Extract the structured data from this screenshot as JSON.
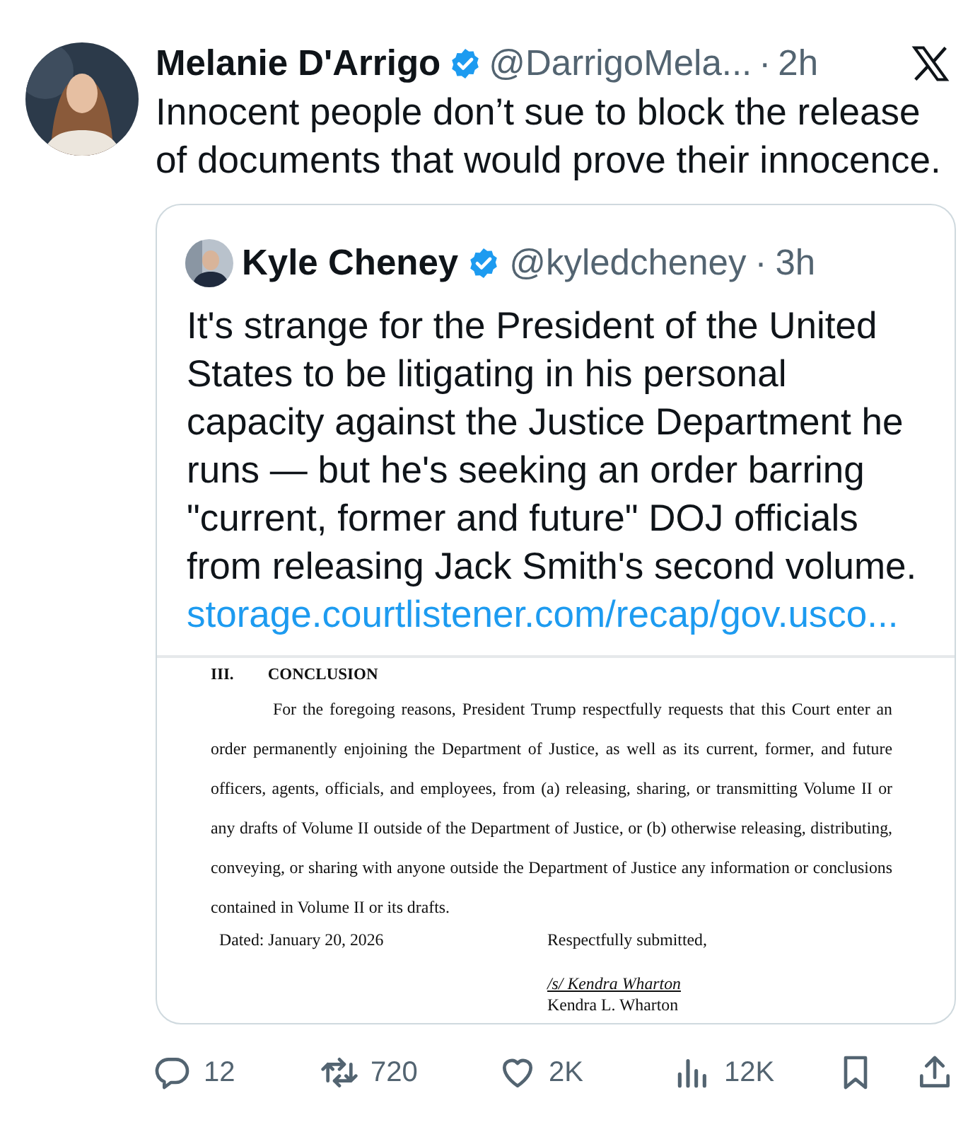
{
  "tweet": {
    "author": {
      "name": "Melanie D'Arrigo",
      "verified": true,
      "handle": "@DarrigoMela...",
      "separator": "·",
      "time": "2h"
    },
    "text": "Innocent people don’t sue to block the release of documents that would prove their innocence.",
    "quote": {
      "author": {
        "name": "Kyle Cheney",
        "verified": true,
        "handle": "@kyledcheney",
        "separator": "·",
        "time": "3h"
      },
      "text": "It's strange for the President of the United States to be litigating in his personal capacity against the Justice Department he runs — but he's seeking an order barring \"current, former and future\" DOJ officials from releasing Jack Smith's second volume.",
      "link": "storage.courtlistener.com/recap/gov.usco...",
      "document": {
        "heading_number": "III.",
        "heading": "CONCLUSION",
        "paragraph": "For the foregoing reasons, President Trump respectfully requests that this Court enter an order permanently enjoining the Department of Justice, as well as its current, former, and future officers, agents, officials, and employees, from (a) releasing, sharing, or transmitting Volume II or any drafts of Volume II outside of the Department of Justice, or (b) otherwise releasing, distributing, conveying, or sharing with anyone outside the Department of Justice any information or conclusions contained in Volume II or its drafts.",
        "dated": "Dated: January 20, 2026",
        "closing": "Respectfully submitted,",
        "signature": "/s/ Kendra Wharton",
        "signer": "Kendra L. Wharton"
      }
    },
    "actions": [
      {
        "kind": "reply",
        "count": "12"
      },
      {
        "kind": "repost",
        "count": "720"
      },
      {
        "kind": "like",
        "count": "2K"
      },
      {
        "kind": "views",
        "count": "12K"
      },
      {
        "kind": "bookmark"
      },
      {
        "kind": "share"
      }
    ]
  }
}
